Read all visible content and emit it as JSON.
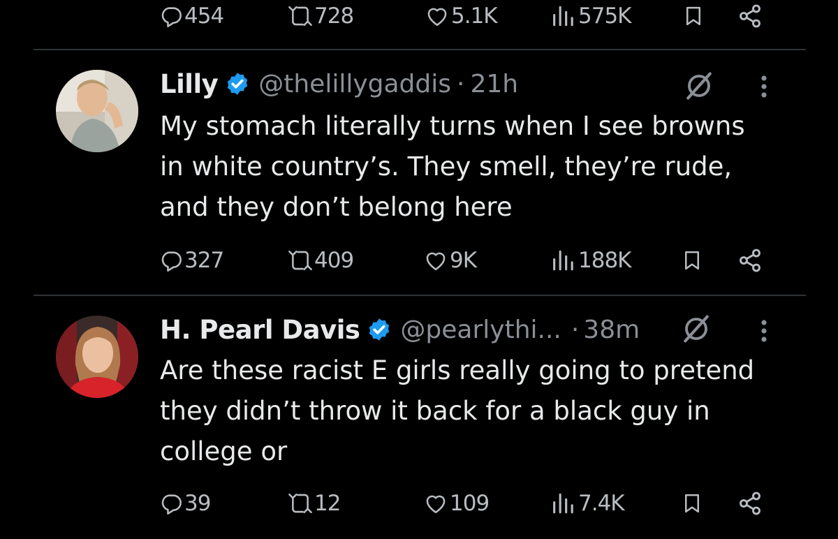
{
  "top_actions": {
    "replies": "454",
    "reposts": "728",
    "likes": "5.1K",
    "views": "575K"
  },
  "tweets": [
    {
      "name": "Lilly",
      "handle": "@thelillygaddis",
      "separator": "·",
      "time": "21h",
      "text_lines": [
        "My stomach literally turns when I see browns",
        "in white country’s. They smell, they’re rude,",
        "and they don’t belong here"
      ],
      "replies": "327",
      "reposts": "409",
      "likes": "9K",
      "views": "188K"
    },
    {
      "name": "H. Pearl Davis",
      "handle": "@pearlythi...",
      "separator": "·",
      "time": "38m",
      "text_lines": [
        "Are these racist E girls really going to pretend",
        "they didn’t throw it back for a black guy in",
        "college or"
      ],
      "replies": "39",
      "reposts": "12",
      "likes": "109",
      "views": "7.4K"
    }
  ],
  "colors": {
    "background": "#000000",
    "text": "#e7e9ea",
    "muted": "#8b9096",
    "verified_badge": "#1d9bf0",
    "divider": "#2f3336"
  },
  "icons": [
    "reply-icon",
    "repost-icon",
    "like-icon",
    "views-icon",
    "bookmark-icon",
    "share-icon",
    "grok-icon",
    "more-icon",
    "verified-badge-icon"
  ]
}
